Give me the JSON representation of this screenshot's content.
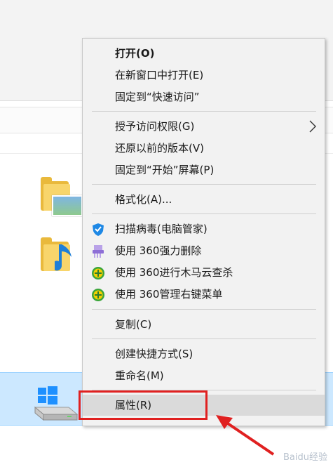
{
  "menu": {
    "items": [
      {
        "label": "打开(O)",
        "bold": true
      },
      {
        "label": "在新窗口中打开(E)"
      },
      {
        "label": "固定到“快速访问”"
      },
      {
        "label": "授予访问权限(G)",
        "submenu": true
      },
      {
        "label": "还原以前的版本(V)"
      },
      {
        "label": "固定到“开始”屏幕(P)"
      },
      {
        "label": "格式化(A)..."
      },
      {
        "label": "扫描病毒(电脑管家)",
        "icon": "shield-icon"
      },
      {
        "label": "使用 360强力删除",
        "icon": "shredder-icon"
      },
      {
        "label": "使用 360进行木马云查杀",
        "icon": "360-plus-icon"
      },
      {
        "label": "使用 360管理右键菜单",
        "icon": "360-plus-icon"
      },
      {
        "label": "复制(C)"
      },
      {
        "label": "创建快捷方式(S)"
      },
      {
        "label": "重命名(M)"
      },
      {
        "label": "属性(R)",
        "highlighted": true
      }
    ]
  },
  "colors": {
    "accent_red": "#e02020",
    "selection_blue": "#cce8ff",
    "menu_bg": "#f2f2f2"
  },
  "watermark": "Baidu经验",
  "drive_label": "——·——"
}
